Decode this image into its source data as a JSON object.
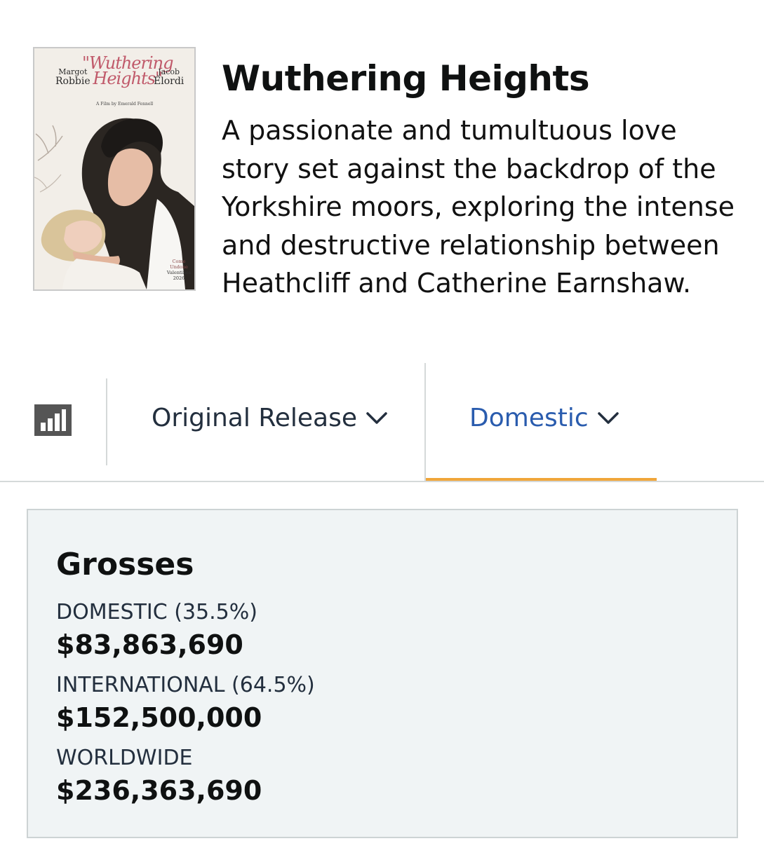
{
  "movie": {
    "title": "Wuthering Heights",
    "synopsis": "A passionate and tumultuous love story set against the backdrop of the Yorkshire moors, exploring the intense and destructive relationship between Heathcliff and Catherine Earnshaw.",
    "poster": {
      "actor_left_first": "Margot",
      "actor_left_last": "Robbie",
      "title_line1": "\"Wuthering",
      "title_line2": "Heights\"",
      "actor_right_first": "Jacob",
      "actor_right_last": "Elordi",
      "credit": "A Film by Emerald Fennell",
      "tagline1": "Come Undone",
      "tagline2": "Valentines",
      "year": "2026"
    }
  },
  "tabs": {
    "chart_icon": "bar-chart-icon",
    "release": {
      "label": "Original Release",
      "icon": "chevron-down-icon"
    },
    "region": {
      "label": "Domestic",
      "icon": "chevron-down-icon",
      "active": true
    }
  },
  "grosses": {
    "title": "Grosses",
    "rows": [
      {
        "label": "DOMESTIC (35.5%)",
        "value": "$83,863,690"
      },
      {
        "label": "INTERNATIONAL (64.5%)",
        "value": "$152,500,000"
      },
      {
        "label": "WORLDWIDE",
        "value": "$236,363,690"
      }
    ]
  },
  "colors": {
    "link_blue": "#2a5cae",
    "active_underline": "#f0a63a",
    "card_bg": "#f0f4f5",
    "icon_gray": "#555555"
  }
}
